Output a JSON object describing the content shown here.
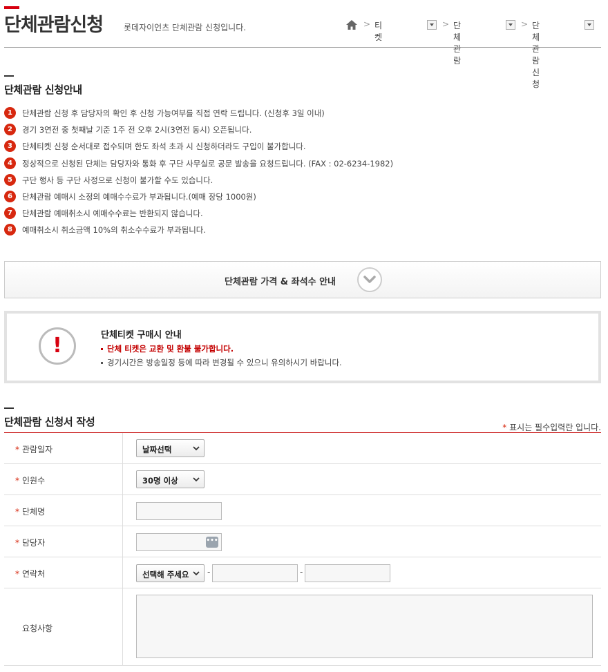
{
  "header": {
    "title": "단체관람신청",
    "subtitle": "롯데자이언츠 단체관람 신청입니다.",
    "breadcrumb": [
      "티켓",
      "단체관람",
      "단체관람신청"
    ]
  },
  "guide": {
    "title": "단체관람 신청안내",
    "items": [
      {
        "num": "1",
        "text": "단체관람 신청 후 담당자의 확인 후 신청 가능여부를 직접 연락 드립니다. (신청후 3일 이내)"
      },
      {
        "num": "2",
        "text": "경기 3연전 중 첫째날 기준 1주 전 오후 2시(3연전 동시) 오픈됩니다."
      },
      {
        "num": "3",
        "text": "단체티켓 신청 순서대로 접수되며 한도 좌석 초과 시 신청하더라도 구입이 불가합니다."
      },
      {
        "num": "4",
        "text": "정상적으로 신청된 단체는 담당자와 통화 후 구단 사무실로 공문 발송을 요청드립니다. (FAX : 02-6234-1982)"
      },
      {
        "num": "5",
        "text": "구단 행사 등 구단 사정으로 신청이 불가할 수도 있습니다."
      },
      {
        "num": "6",
        "text": "단체관람 예매시 소정의 예매수수료가 부과됩니다.(예매 장당 1000원)"
      },
      {
        "num": "7",
        "text": "단체관람 예매취소시 예매수수료는 반환되지 않습니다."
      },
      {
        "num": "8",
        "text": "예매취소시 취소금액 10%의 취소수수료가 부과됩니다."
      }
    ]
  },
  "price_toggle": {
    "label": "단체관람 가격 & 좌석수 안내",
    "icon": "chevron-down-icon"
  },
  "notice": {
    "title": "단체티켓 구매시 안내",
    "warning": "단체 티켓은 교환 및 환불 불가합니다.",
    "info": "경기시간은 방송일정 등에 따라 변경될 수 있으니 유의하시기 바랍니다.",
    "icon": "exclamation-icon"
  },
  "form": {
    "title": "단체관람 신청서 작성",
    "required_star": "*",
    "required_note": "표시는 필수입력란 입니다.",
    "fields": {
      "date": {
        "label": "관람일자",
        "value": "날짜선택"
      },
      "count": {
        "label": "인원수",
        "value": "30명 이상"
      },
      "group": {
        "label": "단체명",
        "value": ""
      },
      "manager": {
        "label": "담당자",
        "value": ""
      },
      "contact": {
        "label": "연락처",
        "value": "선택해 주세요",
        "sep": "-"
      },
      "request": {
        "label": "요청사항",
        "value": ""
      }
    }
  },
  "colors": {
    "accent": "#d7000f",
    "badge": "#d7280f",
    "warning": "#c40000"
  }
}
